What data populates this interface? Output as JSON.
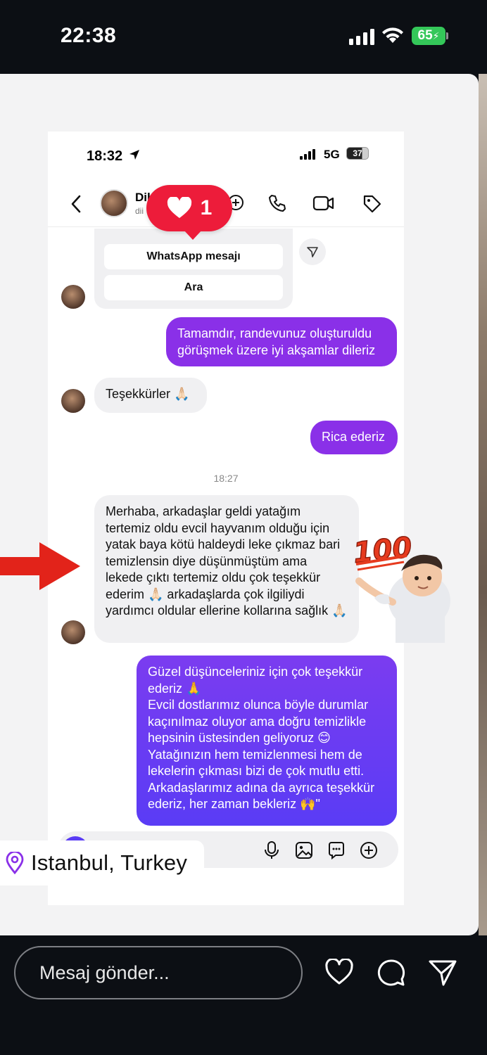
{
  "outer_status": {
    "time": "22:38",
    "battery": "65"
  },
  "inner_status": {
    "time": "18:32",
    "network": "5G",
    "battery": "37"
  },
  "header": {
    "name": "Dil",
    "username": "dii"
  },
  "like_badge": {
    "count": "1"
  },
  "card": {
    "whatsapp_label": "WhatsApp mesajı",
    "call_label": "Ara"
  },
  "messages": {
    "m1": "Tamamdır, randevunuz oluşturuldu görüşmek üzere iyi akşamlar dileriz",
    "m2": "Teşekkürler 🙏🏻",
    "m3": "Rica ederiz",
    "timestamp": "18:27",
    "m4": "Merhaba, arkadaşlar geldi yatağım tertemiz oldu evcil hayvanım olduğu için yatak baya kötü haldeydi leke çıkmaz bari temizlensin diye düşünmüştüm ama lekede çıktı tertemiz oldu çok teşekkür ederim 🙏🏻 arkadaşlarda çok ilgiliydi yardımcı oldular ellerine kollarına sağlık 🙏🏻",
    "m5_p1": "Güzel düşünceleriniz için çok teşekkür ederiz 🙏",
    "m5_p2": "Evcil dostlarımız olunca böyle durumlar kaçınılmaz oluyor ama doğru temizlikle hepsinin üstesinden geliyoruz 😊",
    "m5_p3": "Yatağınızın hem temizlenmesi hem de lekelerin çıkması bizi de çok mutlu etti.",
    "m5_p4": "Arkadaşlarımız adına da ayrıca teşekkür ederiz, her zaman bekleriz 🙌\""
  },
  "sticker": {
    "label": "100"
  },
  "location": {
    "text": "Istanbul, Turkey"
  },
  "bottom_bar": {
    "placeholder": "Mesaj gönder..."
  },
  "colors": {
    "accent_purple": "#8a30e8",
    "like_red": "#ed1c3a",
    "arrow_red": "#e2231a"
  },
  "icons": [
    "location-pin-icon",
    "heart-icon",
    "comment-icon",
    "send-icon",
    "mic-icon",
    "gallery-icon",
    "sticker-icon",
    "plus-icon",
    "phone-icon",
    "video-icon",
    "tag-icon",
    "back-icon"
  ]
}
